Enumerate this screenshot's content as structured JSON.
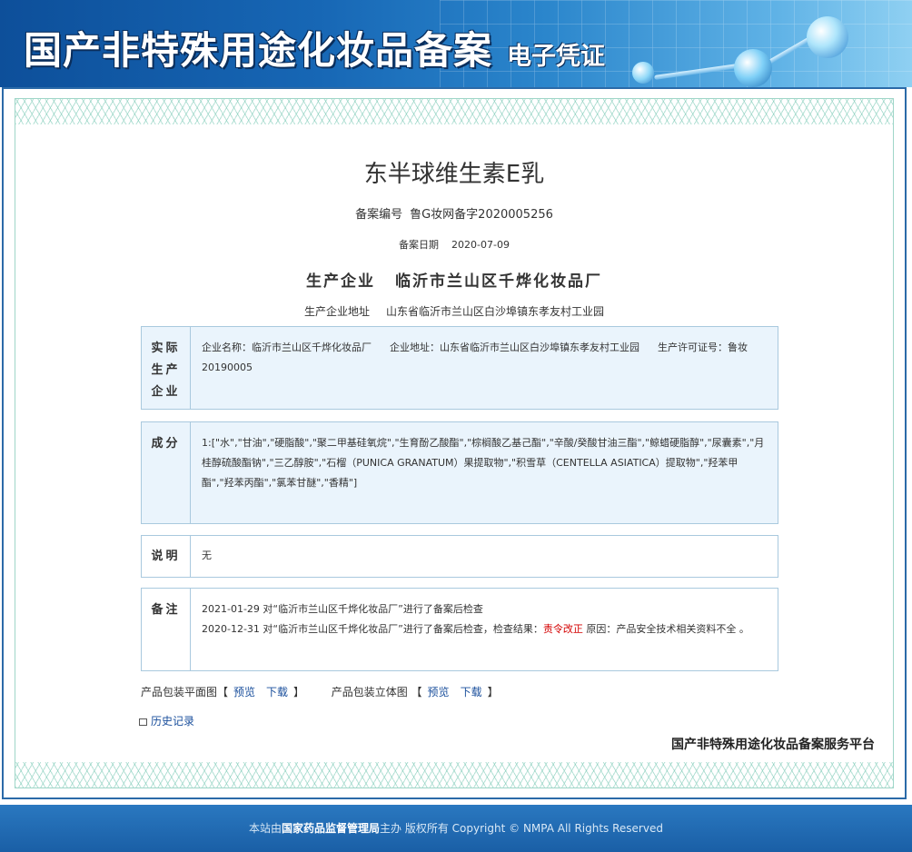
{
  "banner": {
    "title": "国产非特殊用途化妆品备案",
    "subtitle": "电子凭证"
  },
  "product": {
    "name": "东半球维生素E乳",
    "reg_no_label": "备案编号",
    "reg_no": "鲁G妆网备字2020005256",
    "reg_date_label": "备案日期",
    "reg_date": "2020-07-09",
    "maker_label": "生产企业",
    "maker": "临沂市兰山区千烨化妆品厂",
    "address_label": "生产企业地址",
    "address": "山东省临沂市兰山区白沙埠镇东孝友村工业园"
  },
  "actual_maker": {
    "head": [
      "实际",
      "生产",
      "企业"
    ],
    "name": "企业名称：临沂市兰山区千烨化妆品厂",
    "address": "企业地址：山东省临沂市兰山区白沙埠镇东孝友村工业园",
    "license": "生产许可证号：鲁妆20190005"
  },
  "ingredients": {
    "head": "成分",
    "text": "1:[\"水\",\"甘油\",\"硬脂酸\",\"聚二甲基硅氧烷\",\"生育酚乙酸酯\",\"棕榈酸乙基己酯\",\"辛酸/癸酸甘油三酯\",\"鲸蜡硬脂醇\",\"尿囊素\",\"月桂醇硫酸酯钠\",\"三乙醇胺\",\"石榴（PUNICA GRANATUM）果提取物\",\"积雪草（CENTELLA ASIATICA）提取物\",\"羟苯甲酯\",\"羟苯丙酯\",\"氯苯甘醚\",\"香精\"]"
  },
  "notes": {
    "head": "说明",
    "text": "无"
  },
  "remarks": {
    "head": "备注",
    "line1": "2021-01-29 对“临沂市兰山区千烨化妆品厂”进行了备案后检查",
    "line2_pre": "2020-12-31 对“临沂市兰山区千烨化妆品厂”进行了备案后检查，检查结果：",
    "line2_result": "责令改正",
    "line2_post": " 原因：产品安全技术相关资料不全 。"
  },
  "package": {
    "flat_label": "产品包装平面图【",
    "preview": "预览",
    "download": "下载",
    "close": "】",
    "solid_label": "产品包装立体图 【"
  },
  "history_label": "历史记录",
  "platform_name": "国产非特殊用途化妆品备案服务平台",
  "footer": {
    "pre": "本站由",
    "org": "国家药品监督管理局",
    "post": "主办 版权所有 Copyright © NMPA All Rights Reserved"
  }
}
